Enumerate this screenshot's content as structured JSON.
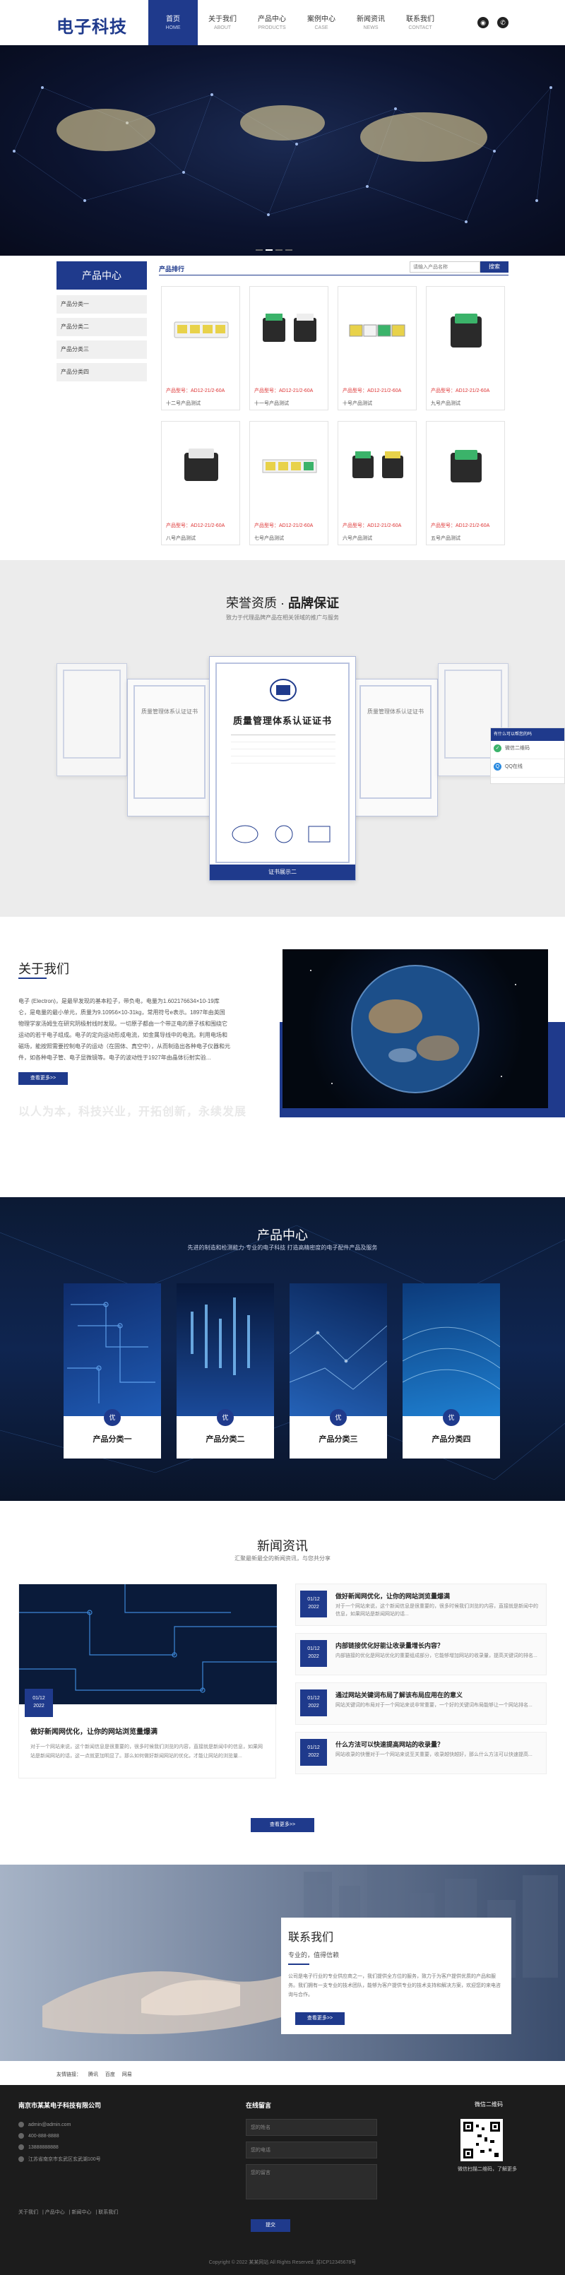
{
  "header": {
    "logo": "电子科技",
    "nav": [
      {
        "cn": "首页",
        "en": "HOME"
      },
      {
        "cn": "关于我们",
        "en": "ABOUT"
      },
      {
        "cn": "产品中心",
        "en": "PRODUCTS"
      },
      {
        "cn": "案例中心",
        "en": "CASE"
      },
      {
        "cn": "新闻资讯",
        "en": "NEWS"
      },
      {
        "cn": "联系我们",
        "en": "CONTACT"
      }
    ]
  },
  "products": {
    "sidebar_title": "产品中心",
    "categories": [
      "产品分类一",
      "产品分类二",
      "产品分类三",
      "产品分类四"
    ],
    "list_label": "产品排行",
    "search_placeholder": "请输入产品名称",
    "search_button": "搜索",
    "items": [
      {
        "code": "产品型号：AD12-21/2-60A",
        "name": "十二号产品测试"
      },
      {
        "code": "产品型号：AD12-21/2-60A",
        "name": "十一号产品测试"
      },
      {
        "code": "产品型号：AD12-21/2-60A",
        "name": "十号产品测试"
      },
      {
        "code": "产品型号：AD12-21/2-60A",
        "name": "九号产品测试"
      },
      {
        "code": "产品型号：AD12-21/2-60A",
        "name": "八号产品测试"
      },
      {
        "code": "产品型号：AD12-21/2-60A",
        "name": "七号产品测试"
      },
      {
        "code": "产品型号：AD12-21/2-60A",
        "name": "六号产品测试"
      },
      {
        "code": "产品型号：AD12-21/2-60A",
        "name": "五号产品测试"
      }
    ]
  },
  "honor": {
    "title_prefix": "荣誉资质 · ",
    "title_strong": "品牌保证",
    "subtitle": "致力于代理品牌产品在相关领域的推广与服务",
    "center_cert_title": "质量管理体系认证证书",
    "center_caption": "证书展示二",
    "side_cert_title": "质量管理体系认证证书"
  },
  "float_panel": {
    "head": "有什么可以帮您的吗",
    "wechat": "微信二维码",
    "qq": "QQ在线"
  },
  "about": {
    "title": "关于我们",
    "text": "电子 (Electron)，是最早发现的基本粒子，带负电，电量为1.602176634×10-19库仑，是电量的最小单元，质量为9.10956×10-31kg，常用符号e表示。1897年由英国物理学家汤姆生在研究阴极射线时发现。一切原子都由一个带正电的原子核和围绕它运动的若干电子组成。电子的定向运动形成电流，如金属导线中的电流。利用电场和磁场，能按照需要控制电子的运动（在固体、真空中），从而制造出各种电子仪器和元件，如各种电子管、电子显微镜等。电子的波动性于1927年由晶体衍射实验...",
    "button": "查看更多>>",
    "slogan": "以人为本，科技兴业，开拓创新，永续发展"
  },
  "product_center": {
    "title": "产品中心",
    "subtitle": "先进的制造和检测能力·专业的电子科技 打造高精密度的电子配件产品及服务",
    "badge": "优",
    "items": [
      "产品分类一",
      "产品分类二",
      "产品分类三",
      "产品分类四"
    ]
  },
  "news": {
    "title": "新闻资讯",
    "subtitle": "汇聚最新最全的新闻资讯，与您共分享",
    "big": {
      "month": "01/12",
      "year": "2022",
      "title": "做好新闻网优化，让你的网站浏览量爆满",
      "text": "对于一个网站来说，这个新闻信息是很重要的，很多时候我们浏览的内容，直接就是新闻中的信息，如果网站是新闻网站的话，这一点就更加明显了。那么如何做好新闻网站的优化，才能让网站的浏览量..."
    },
    "items": [
      {
        "month": "01/12",
        "year": "2022",
        "title": "做好新闻网优化，让你的网站浏览量爆满",
        "text": "对于一个网站来说，这个新闻信息是很重要的，很多时候我们浏览的内容，直接就是新闻中的信息，如果网站是新闻网站的话..."
      },
      {
        "month": "01/12",
        "year": "2022",
        "title": "内部链接优化好能让收录量增长内容？",
        "text": "内部链接的优化是网站优化的重要组成部分，它能够增加网站的收录量，提高关键词的排名..."
      },
      {
        "month": "01/12",
        "year": "2022",
        "title": "通过网站关键词布局了解该布局应用在的意义",
        "text": "网站关键词的布局对于一个网站来说非常重要，一个好的关键词布局能够让一个网站排名..."
      },
      {
        "month": "01/12",
        "year": "2022",
        "title": "什么方法可以快速提高网站的收录量？",
        "text": "网站收录的快慢对于一个网站来说至关重要，收录越快越好，那么什么方法可以快速提高..."
      }
    ],
    "button": "查看更多>>"
  },
  "contact": {
    "title": "联系我们",
    "subtitle": "专业的，值得信赖",
    "text": "公司是电子行业的专业供应商之一，我们提供全方位的服务，致力于为客户提供优质的产品和服务。我们拥有一支专业的技术团队，能够为客户提供专业的技术支持和解决方案，欢迎您的来电咨询与合作。",
    "button": "查看更多>>"
  },
  "links": {
    "label": "友情链接：",
    "items": [
      "腾讯",
      "百度",
      "网易"
    ]
  },
  "footer": {
    "company": "南京市某某电子科技有限公司",
    "email": "admin@admin.com",
    "phone": "400-888-8888",
    "mobile": "13888888888",
    "address": "江苏省南京市玄武区玄武湖100号",
    "msg_title": "在线留言",
    "name_ph": "您的姓名",
    "phone_ph": "您的电话",
    "content_ph": "您的留言",
    "submit": "提交",
    "qr_title": "微信二维码",
    "qr_caption": "微信扫描二维码，了解更多",
    "nav": [
      "关于我们",
      "产品中心",
      "新闻中心",
      "联系我们"
    ],
    "copyright": "Copyright © 2022 某某网站 All Rights Reserved. 苏ICP12345678号"
  },
  "colors": {
    "brand": "#1f3a8c",
    "price": "#d33333",
    "footer_bg": "#1c1c1c"
  }
}
